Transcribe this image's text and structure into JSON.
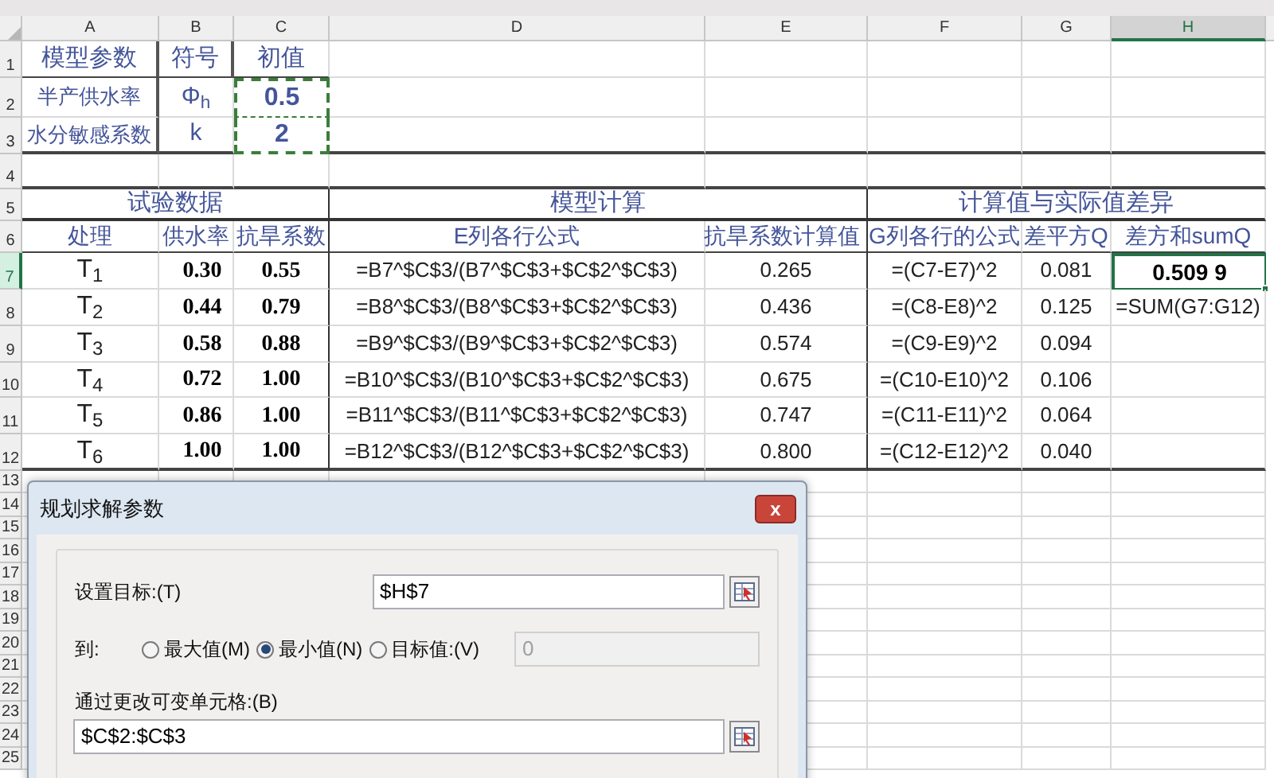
{
  "column_headers": [
    {
      "label": "A",
      "selected": false
    },
    {
      "label": "B",
      "selected": false
    },
    {
      "label": "C",
      "selected": false
    },
    {
      "label": "D",
      "selected": false
    },
    {
      "label": "E",
      "selected": false
    },
    {
      "label": "F",
      "selected": false
    },
    {
      "label": "G",
      "selected": false
    },
    {
      "label": "H",
      "selected": true
    }
  ],
  "row_headers": [
    {
      "label": "1",
      "selected": false
    },
    {
      "label": "2",
      "selected": false
    },
    {
      "label": "3",
      "selected": false
    },
    {
      "label": "4",
      "selected": false
    },
    {
      "label": "5",
      "selected": false
    },
    {
      "label": "6",
      "selected": false
    },
    {
      "label": "7",
      "selected": true
    },
    {
      "label": "8",
      "selected": false
    },
    {
      "label": "9",
      "selected": false
    },
    {
      "label": "10",
      "selected": false
    },
    {
      "label": "11",
      "selected": false
    },
    {
      "label": "12",
      "selected": false
    },
    {
      "label": "13",
      "selected": false
    },
    {
      "label": "14",
      "selected": false
    },
    {
      "label": "15",
      "selected": false
    },
    {
      "label": "16",
      "selected": false
    },
    {
      "label": "17",
      "selected": false
    },
    {
      "label": "18",
      "selected": false
    },
    {
      "label": "19",
      "selected": false
    },
    {
      "label": "20",
      "selected": false
    },
    {
      "label": "21",
      "selected": false
    },
    {
      "label": "22",
      "selected": false
    },
    {
      "label": "23",
      "selected": false
    },
    {
      "label": "24",
      "selected": false
    },
    {
      "label": "25",
      "selected": false
    }
  ],
  "param_table": {
    "headers": [
      "模型参数",
      "符号",
      "初值"
    ],
    "values_marquee": true,
    "rows": [
      {
        "name": "半产供水率",
        "symbol": "Φ$_{h}$",
        "value": "0.5"
      },
      {
        "name": "水分敏感系数",
        "symbol": "k",
        "value": "2"
      }
    ]
  },
  "sections": [
    "试验数据",
    "模型计算",
    "计算值与实际值差异"
  ],
  "data_headers": [
    "处理",
    "供水率",
    "抗旱系数",
    "E列各行公式",
    "抗旱系数计算值",
    "G列各行的公式",
    "差平方Q",
    "差方和sumQ"
  ],
  "data_rows": [
    {
      "treatment": "T$_{1}$",
      "supply": "0.30",
      "coefficient": "0.55",
      "formula_e": "=B7^$C$3/(B7^$C$3+$C$2^$C$3)",
      "computed": "0.265",
      "formula_g": "=(C7-E7)^2",
      "squared": "0.081",
      "result": {
        "text": "0.509 9",
        "selected": true
      }
    },
    {
      "treatment": "T$_{2}$",
      "supply": "0.44",
      "coefficient": "0.79",
      "formula_e": "=B8^$C$3/(B8^$C$3+$C$2^$C$3)",
      "computed": "0.436",
      "formula_g": "=(C8-E8)^2",
      "squared": "0.125",
      "result": {
        "text": "=SUM(G7:G12)",
        "selected": false
      }
    },
    {
      "treatment": "T$_{3}$",
      "supply": "0.58",
      "coefficient": "0.88",
      "formula_e": "=B9^$C$3/(B9^$C$3+$C$2^$C$3)",
      "computed": "0.574",
      "formula_g": "=(C9-E9)^2",
      "squared": "0.094"
    },
    {
      "treatment": "T$_{4}$",
      "supply": "0.72",
      "coefficient": "1.00",
      "formula_e": "=B10^$C$3/(B10^$C$3+$C$2^$C$3)",
      "computed": "0.675",
      "formula_g": "=(C10-E10)^2",
      "squared": "0.106"
    },
    {
      "treatment": "T$_{5}$",
      "supply": "0.86",
      "coefficient": "1.00",
      "formula_e": "=B11^$C$3/(B11^$C$3+$C$2^$C$3)",
      "computed": "0.747",
      "formula_g": "=(C11-E11)^2",
      "squared": "0.064"
    },
    {
      "treatment": "T$_{6}$",
      "supply": "1.00",
      "coefficient": "1.00",
      "formula_e": "=B12^$C$3/(B12^$C$3+$C$2^$C$3)",
      "computed": "0.800",
      "formula_g": "=(C12-E12)^2",
      "squared": "0.040"
    }
  ],
  "dialog": {
    "title": "规划求解参数",
    "close": "x",
    "target_label": "设置目标:(T)",
    "target_value": "$H$7",
    "to_label": "到:",
    "options": [
      {
        "label": "最大值(M)",
        "selected": false
      },
      {
        "label": "最小值(N)",
        "selected": true
      },
      {
        "label": "目标值:(V)",
        "selected": false
      }
    ],
    "target_amount": {
      "value": "0",
      "disabled": true
    },
    "cells_label": "通过更改可变单元格:(B)",
    "cells_value": "$C$2:$C$3"
  }
}
